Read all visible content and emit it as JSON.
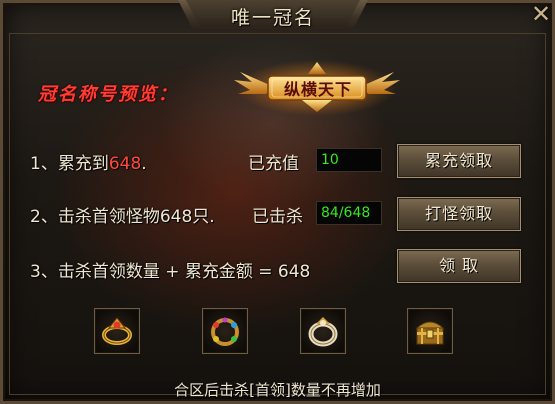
{
  "header": {
    "title": "唯一冠名"
  },
  "preview": {
    "label": "冠名称号预览：",
    "badge_text": "纵横天下"
  },
  "rows": [
    {
      "prefix": "1、累充到",
      "highlight": "648",
      "suffix": ".",
      "status_label": "已充值",
      "status_value": "10",
      "button": "累充领取"
    },
    {
      "prefix": "2、击杀首领怪物",
      "highlight": "648",
      "suffix": "只.",
      "status_label": "已击杀",
      "status_value": "84/648",
      "button": "打怪领取"
    },
    {
      "text": "3、击杀首领数量 + 累充金额 = 648",
      "button": "领 取"
    }
  ],
  "rewards": [
    {
      "icon": "gold-ring-icon"
    },
    {
      "icon": "gem-bracelet-icon"
    },
    {
      "icon": "jade-ring-icon"
    },
    {
      "icon": "treasure-chest-icon"
    }
  ],
  "footer": {
    "note": "合区后击杀[首领]数量不再增加"
  },
  "colors": {
    "accent_red": "#ff4a3c",
    "value_green": "#35e81f",
    "text": "#efe6d0"
  }
}
